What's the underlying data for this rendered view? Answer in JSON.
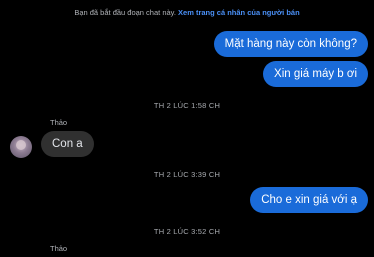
{
  "intro": {
    "text": "Bạn đã bắt đầu đoạn chat này.",
    "link": "Xem trang cá nhân của người bán"
  },
  "messages": [
    {
      "text": "Mặt hàng này còn không?"
    },
    {
      "text": "Xin giá máy b ơi"
    },
    {
      "timestamp": "TH 2 LÚC 1:58 CH"
    },
    {
      "sender": "Thảo",
      "text": "Con a"
    },
    {
      "timestamp": "TH 2 LÚC 3:39 CH"
    },
    {
      "text": "Cho e xin giá với ạ"
    },
    {
      "timestamp": "TH 2 LÚC 3:52 CH"
    },
    {
      "sender": "Thảo"
    }
  ]
}
